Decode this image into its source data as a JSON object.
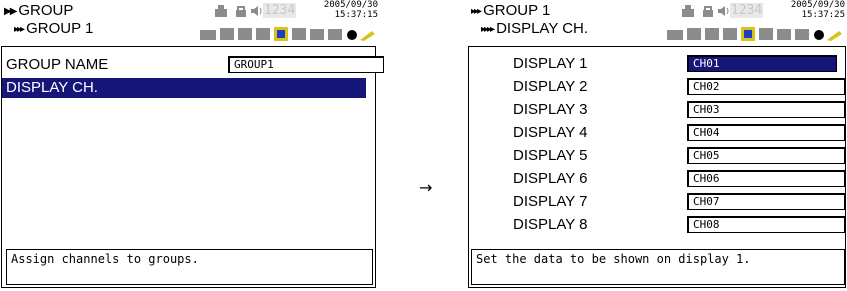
{
  "transition_arrow": "→",
  "left": {
    "breadcrumb": {
      "level1": "GROUP",
      "level2": "GROUP 1"
    },
    "timestamp": {
      "date": "2005/09/30",
      "time": "15:37:15"
    },
    "counter": "1234",
    "params": [
      {
        "label": "GROUP NAME",
        "value": "GROUP1"
      },
      {
        "label": "DISPLAY CH.",
        "value": ""
      }
    ],
    "selected_label": "DISPLAY CH.",
    "message": "Assign channels to groups."
  },
  "right": {
    "breadcrumb": {
      "level1": "GROUP 1",
      "level2": "DISPLAY CH."
    },
    "timestamp": {
      "date": "2005/09/30",
      "time": "15:37:25"
    },
    "counter": "1234",
    "params": [
      {
        "label": "DISPLAY 1",
        "value": "CH01"
      },
      {
        "label": "DISPLAY 2",
        "value": "CH02"
      },
      {
        "label": "DISPLAY 3",
        "value": "CH03"
      },
      {
        "label": "DISPLAY 4",
        "value": "CH04"
      },
      {
        "label": "DISPLAY 5",
        "value": "CH05"
      },
      {
        "label": "DISPLAY 6",
        "value": "CH06"
      },
      {
        "label": "DISPLAY 7",
        "value": "CH07"
      },
      {
        "label": "DISPLAY 8",
        "value": "CH08"
      }
    ],
    "message": "Set the data to be shown on display 1."
  },
  "colors": {
    "highlight": "#16167a",
    "icon_gray": "#8c8c8c",
    "icon_blue": "#1e3fc0",
    "icon_yellow": "#d9c21c"
  }
}
